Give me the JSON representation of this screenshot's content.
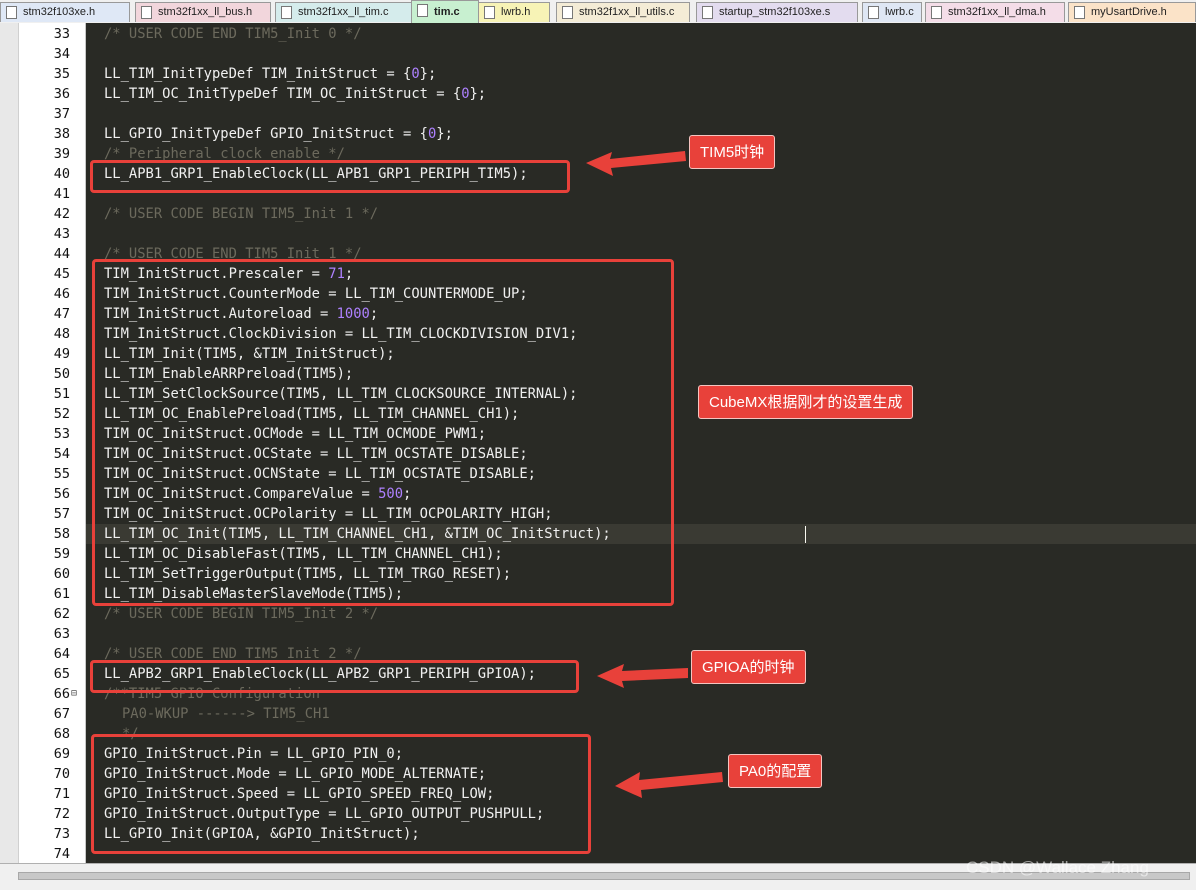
{
  "tabs": [
    {
      "label": "stm32f103xe.h",
      "color": "#dfe8f6",
      "active": false
    },
    {
      "label": "stm32f1xx_ll_bus.h",
      "color": "#f2d6dc",
      "active": false
    },
    {
      "label": "stm32f1xx_ll_tim.c",
      "color": "#d5ecec",
      "active": false
    },
    {
      "label": "tim.c",
      "color": "#c8f0d0",
      "active": true
    },
    {
      "label": "lwrb.h",
      "color": "#f7f3b6",
      "active": false
    },
    {
      "label": "stm32f1xx_ll_utils.c",
      "color": "#f4ecd6",
      "active": false
    },
    {
      "label": "startup_stm32f103xe.s",
      "color": "#e3dcef",
      "active": false
    },
    {
      "label": "lwrb.c",
      "color": "#dfe7f4",
      "active": false
    },
    {
      "label": "stm32f1xx_ll_dma.h",
      "color": "#f4dde8",
      "active": false
    },
    {
      "label": "myUsartDrive.h",
      "color": "#fbe3c8",
      "active": false
    }
  ],
  "lines": [
    {
      "n": "33",
      "fold": "",
      "text": "/* USER CODE END TIM5_Init 0 */",
      "kind": "comment",
      "indent": 1
    },
    {
      "n": "34",
      "fold": "",
      "text": "",
      "kind": "code",
      "indent": 0
    },
    {
      "n": "35",
      "fold": "",
      "text": "LL_TIM_InitTypeDef TIM_InitStruct = {0};",
      "kind": "code",
      "indent": 1
    },
    {
      "n": "36",
      "fold": "",
      "text": "LL_TIM_OC_InitTypeDef TIM_OC_InitStruct = {0};",
      "kind": "code",
      "indent": 1
    },
    {
      "n": "37",
      "fold": "",
      "text": "",
      "kind": "code",
      "indent": 0
    },
    {
      "n": "38",
      "fold": "",
      "text": "LL_GPIO_InitTypeDef GPIO_InitStruct = {0};",
      "kind": "code",
      "indent": 1
    },
    {
      "n": "39",
      "fold": "",
      "text": "/* Peripheral clock enable */",
      "kind": "comment",
      "indent": 1
    },
    {
      "n": "40",
      "fold": "",
      "text": "LL_APB1_GRP1_EnableClock(LL_APB1_GRP1_PERIPH_TIM5);",
      "kind": "code",
      "indent": 1
    },
    {
      "n": "41",
      "fold": "",
      "text": "",
      "kind": "code",
      "indent": 0
    },
    {
      "n": "42",
      "fold": "",
      "text": "/* USER CODE BEGIN TIM5_Init 1 */",
      "kind": "comment",
      "indent": 1
    },
    {
      "n": "43",
      "fold": "",
      "text": "",
      "kind": "code",
      "indent": 0
    },
    {
      "n": "44",
      "fold": "",
      "text": "/* USER CODE END TIM5_Init 1 */",
      "kind": "comment",
      "indent": 1
    },
    {
      "n": "45",
      "fold": "",
      "text": "TIM_InitStruct.Prescaler = 71;",
      "kind": "code",
      "indent": 1
    },
    {
      "n": "46",
      "fold": "",
      "text": "TIM_InitStruct.CounterMode = LL_TIM_COUNTERMODE_UP;",
      "kind": "code",
      "indent": 1
    },
    {
      "n": "47",
      "fold": "",
      "text": "TIM_InitStruct.Autoreload = 1000;",
      "kind": "code",
      "indent": 1
    },
    {
      "n": "48",
      "fold": "",
      "text": "TIM_InitStruct.ClockDivision = LL_TIM_CLOCKDIVISION_DIV1;",
      "kind": "code",
      "indent": 1
    },
    {
      "n": "49",
      "fold": "",
      "text": "LL_TIM_Init(TIM5, &TIM_InitStruct);",
      "kind": "code",
      "indent": 1
    },
    {
      "n": "50",
      "fold": "",
      "text": "LL_TIM_EnableARRPreload(TIM5);",
      "kind": "code",
      "indent": 1
    },
    {
      "n": "51",
      "fold": "",
      "text": "LL_TIM_SetClockSource(TIM5, LL_TIM_CLOCKSOURCE_INTERNAL);",
      "kind": "code",
      "indent": 1
    },
    {
      "n": "52",
      "fold": "",
      "text": "LL_TIM_OC_EnablePreload(TIM5, LL_TIM_CHANNEL_CH1);",
      "kind": "code",
      "indent": 1
    },
    {
      "n": "53",
      "fold": "",
      "text": "TIM_OC_InitStruct.OCMode = LL_TIM_OCMODE_PWM1;",
      "kind": "code",
      "indent": 1
    },
    {
      "n": "54",
      "fold": "",
      "text": "TIM_OC_InitStruct.OCState = LL_TIM_OCSTATE_DISABLE;",
      "kind": "code",
      "indent": 1
    },
    {
      "n": "55",
      "fold": "",
      "text": "TIM_OC_InitStruct.OCNState = LL_TIM_OCSTATE_DISABLE;",
      "kind": "code",
      "indent": 1
    },
    {
      "n": "56",
      "fold": "",
      "text": "TIM_OC_InitStruct.CompareValue = 500;",
      "kind": "code",
      "indent": 1
    },
    {
      "n": "57",
      "fold": "",
      "text": "TIM_OC_InitStruct.OCPolarity = LL_TIM_OCPOLARITY_HIGH;",
      "kind": "code",
      "indent": 1
    },
    {
      "n": "58",
      "fold": "",
      "text": "LL_TIM_OC_Init(TIM5, LL_TIM_CHANNEL_CH1, &TIM_OC_InitStruct);",
      "kind": "code",
      "indent": 1
    },
    {
      "n": "59",
      "fold": "",
      "text": "LL_TIM_OC_DisableFast(TIM5, LL_TIM_CHANNEL_CH1);",
      "kind": "code",
      "indent": 1
    },
    {
      "n": "60",
      "fold": "",
      "text": "LL_TIM_SetTriggerOutput(TIM5, LL_TIM_TRGO_RESET);",
      "kind": "code",
      "indent": 1
    },
    {
      "n": "61",
      "fold": "",
      "text": "LL_TIM_DisableMasterSlaveMode(TIM5);",
      "kind": "code",
      "indent": 1
    },
    {
      "n": "62",
      "fold": "",
      "text": "/* USER CODE BEGIN TIM5_Init 2 */",
      "kind": "comment",
      "indent": 1
    },
    {
      "n": "63",
      "fold": "",
      "text": "",
      "kind": "code",
      "indent": 0
    },
    {
      "n": "64",
      "fold": "",
      "text": "/* USER CODE END TIM5_Init 2 */",
      "kind": "comment",
      "indent": 1
    },
    {
      "n": "65",
      "fold": "",
      "text": "LL_APB2_GRP1_EnableClock(LL_APB2_GRP1_PERIPH_GPIOA);",
      "kind": "code",
      "indent": 1
    },
    {
      "n": "66",
      "fold": "⊟",
      "text": "/**TIM5 GPIO Configuration",
      "kind": "comment",
      "indent": 1
    },
    {
      "n": "67",
      "fold": "",
      "text": "PA0-WKUP ------> TIM5_CH1",
      "kind": "comment",
      "indent": 2
    },
    {
      "n": "68",
      "fold": "",
      "text": "*/",
      "kind": "comment",
      "indent": 2
    },
    {
      "n": "69",
      "fold": "",
      "text": "GPIO_InitStruct.Pin = LL_GPIO_PIN_0;",
      "kind": "code",
      "indent": 1
    },
    {
      "n": "70",
      "fold": "",
      "text": "GPIO_InitStruct.Mode = LL_GPIO_MODE_ALTERNATE;",
      "kind": "code",
      "indent": 1
    },
    {
      "n": "71",
      "fold": "",
      "text": "GPIO_InitStruct.Speed = LL_GPIO_SPEED_FREQ_LOW;",
      "kind": "code",
      "indent": 1
    },
    {
      "n": "72",
      "fold": "",
      "text": "GPIO_InitStruct.OutputType = LL_GPIO_OUTPUT_PUSHPULL;",
      "kind": "code",
      "indent": 1
    },
    {
      "n": "73",
      "fold": "",
      "text": "LL_GPIO_Init(GPIOA, &GPIO_InitStruct);",
      "kind": "code",
      "indent": 1
    },
    {
      "n": "74",
      "fold": "",
      "text": "",
      "kind": "code",
      "indent": 0
    }
  ],
  "current_line": "58",
  "annotations": {
    "tim5_clock": "TIM5时钟",
    "cubemx": "CubeMX根据刚才的设置生成",
    "gpioa_clock": "GPIOA的时钟",
    "pa0_config": "PA0的配置",
    "accent_color": "#e8413a"
  },
  "watermark": "CSDN @Wallace Zhang"
}
